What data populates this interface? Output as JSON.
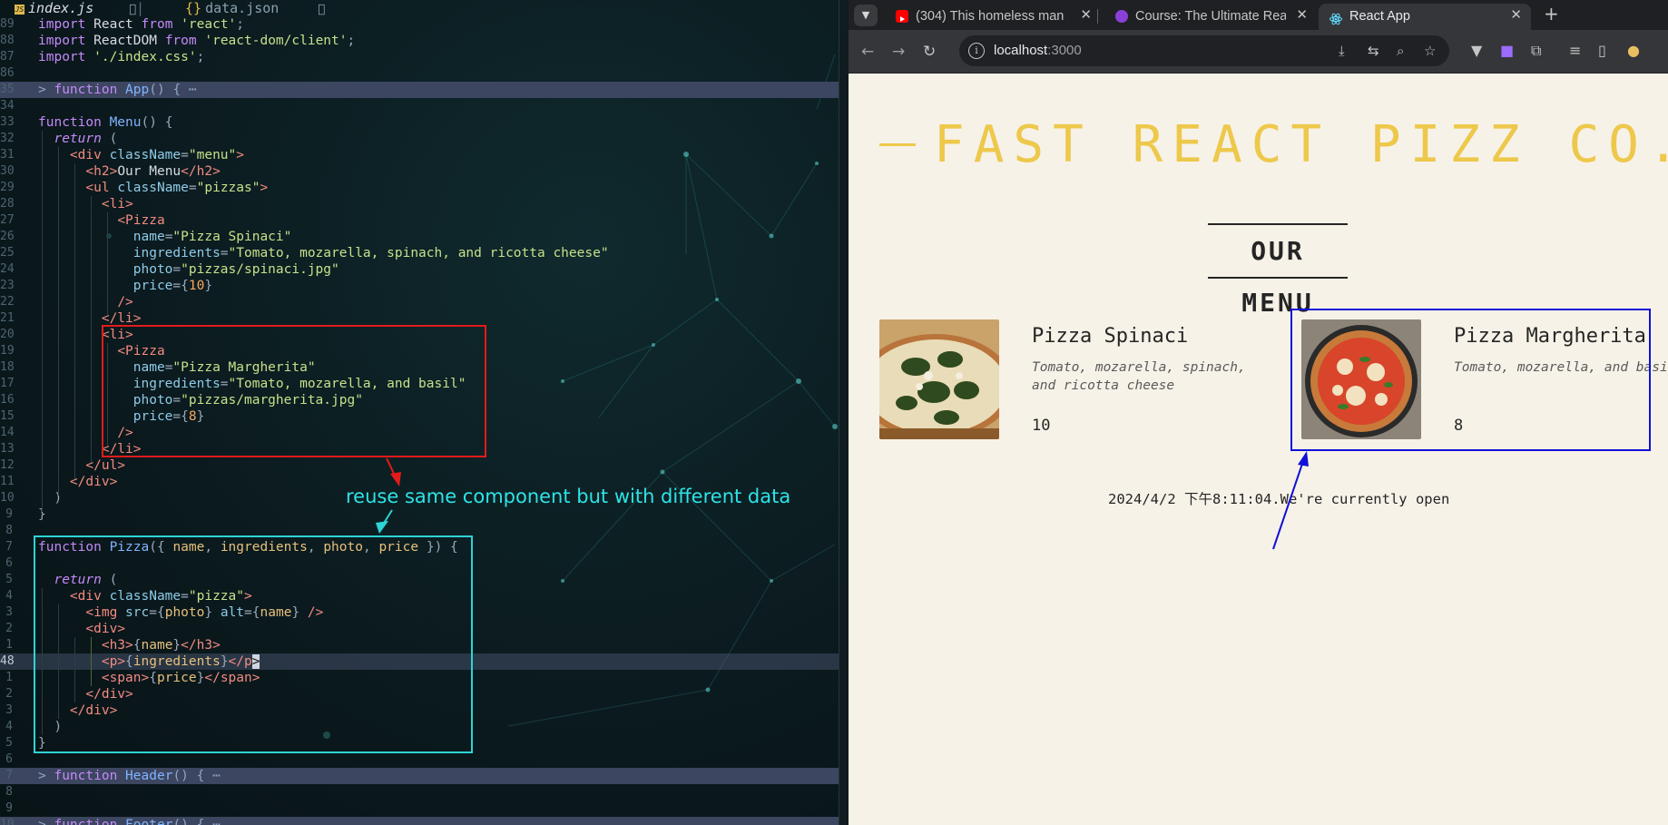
{
  "editor": {
    "tabs": [
      {
        "label": "index.js",
        "glyph": "󰚩",
        "active": true
      },
      {
        "label": "data.json",
        "glyph": "󰚩",
        "active": false
      }
    ],
    "lines": [
      {
        "ln": "89",
        "html": "<span class='k'>import</span> <span class='w'>React</span> <span class='k'>from</span> <span class='s'>'react'</span><span class='p'>;</span>"
      },
      {
        "ln": "88",
        "html": "<span class='k'>import</span> <span class='w'>ReactDOM</span> <span class='k'>from</span> <span class='s'>'react-dom/client'</span><span class='p'>;</span>"
      },
      {
        "ln": "87",
        "html": "<span class='k'>import</span> <span class='s'>'./index.css'</span><span class='p'>;</span>"
      },
      {
        "ln": "86",
        "html": ""
      },
      {
        "ln": "35",
        "html": "&gt; <span class='k'>function</span> <span class='f'>App</span>() { ⋯",
        "fold": true
      },
      {
        "ln": "34",
        "html": ""
      },
      {
        "ln": "33",
        "html": "<span class='k'>function</span> <span class='f'>Menu</span><span class='p'>()</span> <span class='p'>{</span>"
      },
      {
        "ln": "32",
        "html": "  <span class='kw'>return</span> <span class='p'>(</span>"
      },
      {
        "ln": "31",
        "html": "    <span class='t'>&lt;div</span> <span class='a'>className</span><span class='p'>=</span><span class='s'>\"menu\"</span><span class='t'>&gt;</span>"
      },
      {
        "ln": "30",
        "html": "      <span class='t'>&lt;h2&gt;</span><span class='w'>Our Menu</span><span class='t'>&lt;/h2&gt;</span>"
      },
      {
        "ln": "29",
        "html": "      <span class='t'>&lt;ul</span> <span class='a'>className</span><span class='p'>=</span><span class='s'>\"pizzas\"</span><span class='t'>&gt;</span>"
      },
      {
        "ln": "28",
        "html": "        <span class='t'>&lt;li&gt;</span>"
      },
      {
        "ln": "27",
        "html": "          <span class='t'>&lt;Pizza</span>"
      },
      {
        "ln": "26",
        "html": "            <span class='a'>name</span><span class='p'>=</span><span class='s'>\"Pizza Spinaci\"</span>"
      },
      {
        "ln": "25",
        "html": "            <span class='a'>ingredients</span><span class='p'>=</span><span class='s'>\"Tomato, mozarella, spinach, and ricotta cheese\"</span>"
      },
      {
        "ln": "24",
        "html": "            <span class='a'>photo</span><span class='p'>=</span><span class='s'>\"pizzas/spinaci.jpg\"</span>"
      },
      {
        "ln": "23",
        "html": "            <span class='a'>price</span><span class='p'>={</span><span class='n'>10</span><span class='p'>}</span>"
      },
      {
        "ln": "22",
        "html": "          <span class='t'>/&gt;</span>"
      },
      {
        "ln": "21",
        "html": "        <span class='t'>&lt;/li&gt;</span>"
      },
      {
        "ln": "20",
        "html": "        <span class='t'>&lt;li&gt;</span>"
      },
      {
        "ln": "19",
        "html": "          <span class='t'>&lt;Pizza</span>"
      },
      {
        "ln": "18",
        "html": "            <span class='a'>name</span><span class='p'>=</span><span class='s'>\"Pizza Margherita\"</span>"
      },
      {
        "ln": "17",
        "html": "            <span class='a'>ingredients</span><span class='p'>=</span><span class='s'>\"Tomato, mozarella, and basil\"</span>"
      },
      {
        "ln": "16",
        "html": "            <span class='a'>photo</span><span class='p'>=</span><span class='s'>\"pizzas/margherita.jpg\"</span>"
      },
      {
        "ln": "15",
        "html": "            <span class='a'>price</span><span class='p'>={</span><span class='n'>8</span><span class='p'>}</span>"
      },
      {
        "ln": "14",
        "html": "          <span class='t'>/&gt;</span>"
      },
      {
        "ln": "13",
        "html": "        <span class='t'>&lt;/li&gt;</span>"
      },
      {
        "ln": "12",
        "html": "      <span class='t'>&lt;/ul&gt;</span>"
      },
      {
        "ln": "11",
        "html": "    <span class='t'>&lt;/div&gt;</span>"
      },
      {
        "ln": "10",
        "html": "  <span class='p'>)</span>"
      },
      {
        "ln": "9",
        "html": "<span class='p'>}</span>"
      },
      {
        "ln": "8",
        "html": ""
      },
      {
        "ln": "7",
        "html": "<span class='k'>function</span> <span class='f'>Pizza</span><span class='p'>({</span> <span class='v'>name</span><span class='p'>,</span> <span class='v'>ingredients</span><span class='p'>,</span> <span class='v'>photo</span><span class='p'>,</span> <span class='v'>price</span> <span class='p'>})</span> <span class='p'>{</span>"
      },
      {
        "ln": "6",
        "html": ""
      },
      {
        "ln": "5",
        "html": "  <span class='kw'>return</span> <span class='p'>(</span>"
      },
      {
        "ln": "4",
        "html": "    <span class='t'>&lt;div</span> <span class='a'>className</span><span class='p'>=</span><span class='s'>\"pizza\"</span><span class='t'>&gt;</span>"
      },
      {
        "ln": "3",
        "html": "      <span class='t'>&lt;img</span> <span class='a'>src</span><span class='p'>={</span><span class='v'>photo</span><span class='p'>}</span> <span class='a'>alt</span><span class='p'>={</span><span class='v'>name</span><span class='p'>}</span> <span class='t'>/&gt;</span>"
      },
      {
        "ln": "2",
        "html": "      <span class='t'>&lt;div&gt;</span>"
      },
      {
        "ln": "1",
        "html": "        <span class='t'>&lt;h3&gt;</span><span class='p'>{</span><span class='v'>name</span><span class='p'>}</span><span class='t'>&lt;/h3&gt;</span>"
      },
      {
        "ln": "48",
        "html": "        <span class='t'>&lt;p&gt;</span><span class='p'>{</span><span class='v'>ingredients</span><span class='p'>}</span><span class='t'>&lt;/p</span><span class='caret'>&gt;</span>",
        "current": true
      },
      {
        "ln": "1",
        "html": "        <span class='t'>&lt;span&gt;</span><span class='p'>{</span><span class='v'>price</span><span class='p'>}</span><span class='t'>&lt;/span&gt;</span>"
      },
      {
        "ln": "2",
        "html": "      <span class='t'>&lt;/div&gt;</span>"
      },
      {
        "ln": "3",
        "html": "    <span class='t'>&lt;/div&gt;</span>"
      },
      {
        "ln": "4",
        "html": "  <span class='p'>)</span>"
      },
      {
        "ln": "5",
        "html": "<span class='p'>}</span>"
      },
      {
        "ln": "6",
        "html": ""
      },
      {
        "ln": "7",
        "html": "&gt; <span class='k'>function</span> <span class='f'>Header</span>() { ⋯",
        "fold": true
      },
      {
        "ln": "8",
        "html": ""
      },
      {
        "ln": "9",
        "html": ""
      },
      {
        "ln": "10",
        "html": "&gt; <span class='k'>function</span> <span class='f'>Footer</span>() { ⋯",
        "fold": true
      }
    ],
    "annotation": "reuse same component but with different data",
    "colors": {
      "red_box": "#e31b1b",
      "cyan_box": "#2dd4d6",
      "blue_box": "#1010d8"
    }
  },
  "browser": {
    "tabs": [
      {
        "title": "(304) This homeless man",
        "favicon": "youtube-icon",
        "active": false
      },
      {
        "title": "Course: The Ultimate Rea",
        "favicon": "course-icon",
        "active": false
      },
      {
        "title": "React App",
        "favicon": "react-icon",
        "active": true
      }
    ],
    "url_host": "localhost",
    "url_port": ":3000",
    "page": {
      "header": "FAST REACT PIZZ CO.",
      "menu_title": "OUR MENU",
      "pizzas": [
        {
          "name": "Pizza Spinaci",
          "ingredients": "Tomato, mozarella, spinach, and ricotta cheese",
          "price": "10"
        },
        {
          "name": "Pizza Margherita",
          "ingredients": "Tomato, mozarella, and basil",
          "price": "8"
        }
      ],
      "footer": "2024/4/2 下午8:11:04.We're currently open",
      "accent": "#edc84b",
      "background": "#f7f2e8"
    }
  }
}
